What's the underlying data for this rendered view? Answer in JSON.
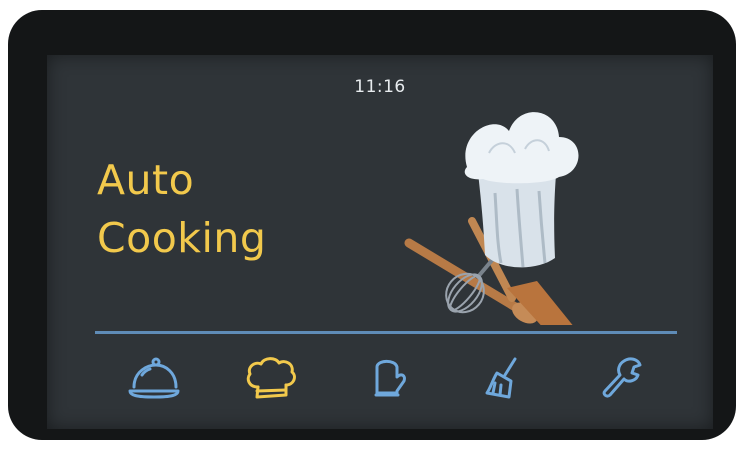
{
  "status": {
    "time": "11:16"
  },
  "title": {
    "line1": "Auto",
    "line2": "Cooking"
  },
  "colors": {
    "accent": "#f2c94c",
    "icon_default": "#6fa8dc",
    "icon_active": "#f2c94c",
    "divider": "#5f8cb7"
  },
  "menu": {
    "items": [
      {
        "icon": "cloche-icon",
        "active": false
      },
      {
        "icon": "chef-hat-icon",
        "active": true
      },
      {
        "icon": "oven-mitt-icon",
        "active": false
      },
      {
        "icon": "brush-icon",
        "active": false
      },
      {
        "icon": "wrench-icon",
        "active": false
      }
    ]
  }
}
